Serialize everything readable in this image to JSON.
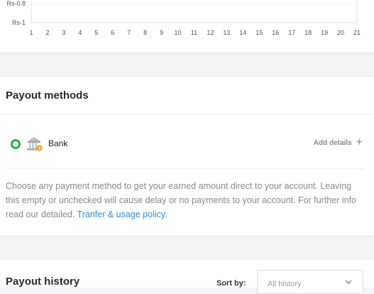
{
  "chart_data": {
    "type": "line",
    "y_tick_labels": [
      "Rs-0.8",
      "Rs-1"
    ],
    "x": [
      "1",
      "2",
      "3",
      "4",
      "5",
      "6",
      "7",
      "8",
      "9",
      "10",
      "11",
      "12",
      "13",
      "14",
      "15",
      "16",
      "17",
      "18",
      "19",
      "20",
      "21"
    ],
    "series": []
  },
  "payout_methods": {
    "title": "Payout methods",
    "items": [
      {
        "label": "Bank",
        "icon": "bank-icon",
        "selected": true,
        "action_label": "Add details",
        "action_icon": "plus-icon"
      }
    ],
    "policy_text": "Choose any payment method to get your earned amount direct to your account. Leaving this empty or unchecked will cause delay or no payments to your account. For further info read our detailed.",
    "policy_link": "Tranfer & usage policy."
  },
  "payout_history": {
    "title": "Payout history",
    "sort_label": "Sort by:",
    "sort_value": "All history"
  },
  "colors": {
    "radio": "#22b14c",
    "link": "#2a8fd4",
    "muted_text": "#8a8a8a"
  }
}
